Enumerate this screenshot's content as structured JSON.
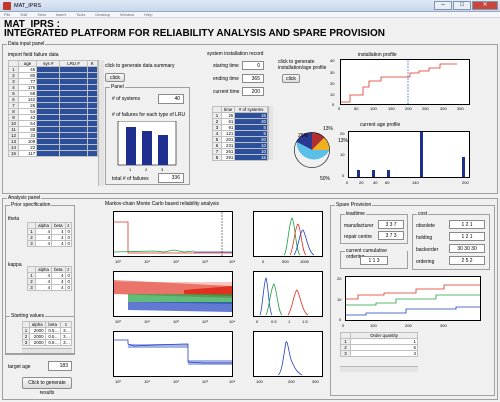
{
  "window": {
    "title": "MAT_IPRS",
    "controls": [
      "–",
      "□",
      "✕"
    ]
  },
  "menu": [
    "File",
    "Edit",
    "View",
    "Insert",
    "Tools",
    "Desktop",
    "Window",
    "Help"
  ],
  "app": {
    "title_line1": "MAT_IPRS :",
    "title_line2": "INTEGRATED  PLATFORM FOR RELIABILITY ANALYSIS AND SPARE PROVISION"
  },
  "data_input": {
    "label": "Data input panel",
    "import_label": "import field failure data",
    "failure_table": {
      "headers": [
        "age",
        "sys #",
        "LRU #",
        "K"
      ],
      "rows": [
        [
          "1",
          "45",
          "",
          "",
          ""
        ],
        [
          "2",
          "80",
          "",
          "",
          ""
        ],
        [
          "3",
          "77",
          "",
          "",
          ""
        ],
        [
          "4",
          "176",
          "",
          "",
          ""
        ],
        [
          "5",
          "68",
          "",
          "",
          ""
        ],
        [
          "6",
          "142",
          "",
          "",
          ""
        ],
        [
          "7",
          "26",
          "",
          "",
          ""
        ],
        [
          "8",
          "54",
          "",
          "",
          ""
        ],
        [
          "9",
          "43",
          "",
          "",
          ""
        ],
        [
          "10",
          "54",
          "",
          "",
          ""
        ],
        [
          "11",
          "88",
          "",
          "",
          ""
        ],
        [
          "12",
          "33",
          "",
          "",
          ""
        ],
        [
          "13",
          "109",
          "",
          "",
          ""
        ],
        [
          "14",
          "22",
          "",
          "",
          ""
        ],
        [
          "15",
          "117",
          "",
          "",
          ""
        ]
      ]
    },
    "summary_label": "click to generate data summary",
    "summary_button": "click",
    "panel_label": "Panel",
    "num_systems_label": "# of systems",
    "num_systems_value": "40",
    "failures_per_lru_label": "# of failures for each type of LRU",
    "total_failures_label": "total # of failures",
    "total_failures_value": "336",
    "install_record_label": "system installation record",
    "starting_time_label": "staring time",
    "starting_time_value": "0",
    "ending_time_label": "ending time",
    "ending_time_value": "365",
    "current_time_label": "current time",
    "current_time_value": "200",
    "profile_click_label_1": "click to generate",
    "profile_click_label_2": "installation/age profile",
    "profile_button": "click",
    "install_table": {
      "headers": [
        "time",
        "# of systems"
      ],
      "rows": [
        [
          "1",
          "25",
          "15"
        ],
        [
          "2",
          "61",
          "20"
        ],
        [
          "3",
          "91",
          "5"
        ],
        [
          "4",
          "121",
          "5"
        ],
        [
          "5",
          "201",
          "20"
        ],
        [
          "6",
          "231",
          "10"
        ],
        [
          "7",
          "261",
          "10"
        ],
        [
          "8",
          "291",
          "15"
        ]
      ]
    },
    "installation_profile_title": "installation profile",
    "current_age_profile_title": "current age profile",
    "pie_labels": [
      "25%",
      "13%",
      "13%",
      "50%"
    ]
  },
  "analysis": {
    "label": "Analysis panel",
    "prior_label": "Prior specification",
    "theta_label": "theta",
    "theta_table": {
      "headers": [
        "alpha",
        "beta",
        "z"
      ],
      "rows": [
        [
          "1",
          "4",
          "4",
          "0"
        ],
        [
          "2",
          "4",
          "4",
          "0"
        ],
        [
          "3",
          "4",
          "4",
          "0"
        ]
      ]
    },
    "kappa_label": "kappa",
    "kappa_table": {
      "headers": [
        "alpha",
        "beta",
        "z"
      ],
      "rows": [
        [
          "1",
          "4",
          "4",
          "0"
        ],
        [
          "2",
          "4",
          "4",
          "0"
        ],
        [
          "3",
          "4",
          "4",
          "0"
        ]
      ]
    },
    "starting_values_label": "Starting values",
    "starting_table": {
      "headers": [
        "alpha",
        "beta",
        "z"
      ],
      "rows": [
        [
          "1",
          "2000",
          "0.5…",
          "3…"
        ],
        [
          "2",
          "2000",
          "0.5…",
          "3…"
        ],
        [
          "3",
          "2000",
          "0.5…",
          "3…"
        ]
      ]
    },
    "target_age_label": "target age",
    "target_age_value": "183",
    "generate_button": "Click to generate results",
    "mcmc_title": "Markov-chain Monte Carlo based reliability analysis",
    "log_ticks": [
      "10⁰",
      "10¹",
      "10²",
      "10³",
      "10⁴"
    ]
  },
  "spare": {
    "label": "Spare Provision",
    "leadtime_label": "leadtime",
    "manufacturer_label": "manufacturer",
    "manufacturer_value": "3 3 7",
    "repair_label": "repair centre",
    "repair_value": "3 7 3",
    "cum_ordering_label": "current cumulative ordering",
    "cum_ordering_value": "1 1 3",
    "cost_label": "cost",
    "obsolete_label": "obsolete",
    "obsolete_value": "1 2 1",
    "holding_label": "holding",
    "holding_value": "1 2 1",
    "backorder_label": "backorder",
    "backorder_value": "30 30 30",
    "ordering_label": "ordering",
    "ordering_value": "2 5 2",
    "order_table": {
      "header": "Order quantity",
      "rows": [
        [
          "1",
          "1"
        ],
        [
          "2",
          "5"
        ],
        [
          "3",
          "3"
        ]
      ]
    }
  },
  "colors": {
    "selected_cell": "#2c4f9c",
    "bar": "#1f2f8f",
    "line_red": "#e03020",
    "line_green": "#20a040",
    "line_blue": "#2040c0"
  }
}
